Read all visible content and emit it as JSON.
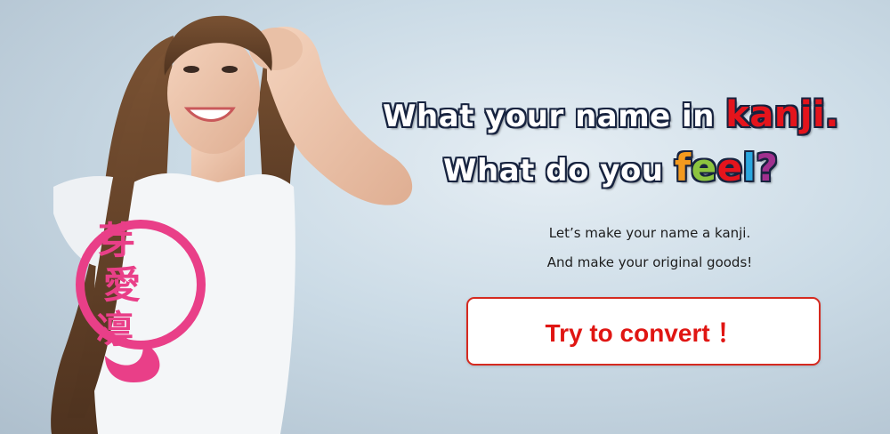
{
  "headline": {
    "line1_prefix": "What your name in",
    "line1_accent": "kanji.",
    "line2_prefix": "What do you",
    "feel_letters": [
      "f",
      "e",
      "e",
      "l"
    ],
    "line2_suffix": "?"
  },
  "subtitle": {
    "line1": "Let’s make your name a kanji.",
    "line2": "And make your original goods!"
  },
  "cta": {
    "label": "Try to convert ！"
  },
  "shirt": {
    "kanji": [
      "芽",
      "愛",
      "凛"
    ]
  },
  "colors": {
    "accent_red": "#e4141c",
    "feel": [
      "#f39a1e",
      "#8cc43f",
      "#e4141c",
      "#2aa7df"
    ],
    "question": "#a0308e",
    "shirt_print": "#e93f88"
  }
}
